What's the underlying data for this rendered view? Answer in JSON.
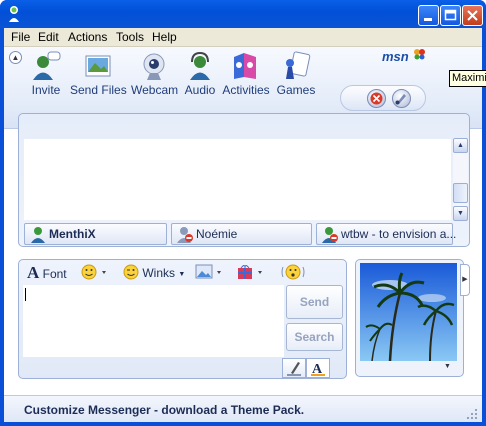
{
  "window": {
    "title": "",
    "controls": [
      "minimize",
      "maximize",
      "close"
    ]
  },
  "menu": [
    "File",
    "Edit",
    "Actions",
    "Tools",
    "Help"
  ],
  "toolbar": {
    "items": [
      {
        "label": "Invite",
        "icon": "invite-icon"
      },
      {
        "label": "Send Files",
        "icon": "send-files-icon"
      },
      {
        "label": "Webcam",
        "icon": "webcam-icon"
      },
      {
        "label": "Audio",
        "icon": "audio-icon"
      },
      {
        "label": "Activities",
        "icon": "activities-icon"
      },
      {
        "label": "Games",
        "icon": "games-icon"
      }
    ],
    "brand": "msn",
    "tooltip": "Maximize"
  },
  "contacts": [
    {
      "name": "MenthiX",
      "status": "online"
    },
    {
      "name": "Noémie",
      "status": "busy"
    },
    {
      "name": "wtbw - to envision a...",
      "status": "busy"
    }
  ],
  "compose": {
    "font_label": "Font",
    "winks_label": "Winks",
    "send_label": "Send",
    "search_label": "Search",
    "value": ""
  },
  "status_bar": {
    "text": "Customize Messenger - download a Theme Pack."
  },
  "colors": {
    "title_blue": "#0a4fd8",
    "close_red": "#c23c1c",
    "accent": "#1c2d55"
  }
}
